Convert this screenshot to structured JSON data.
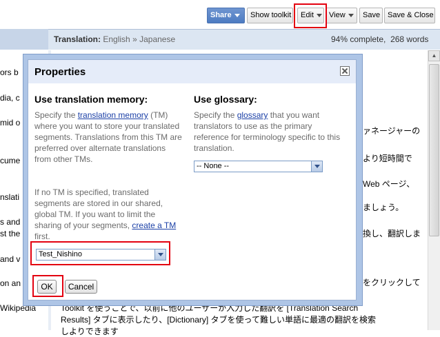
{
  "toolbar": {
    "share_label": "Share",
    "show_toolkit_label": "Show toolkit",
    "edit_label": "Edit",
    "view_label": "View",
    "save_label": "Save",
    "save_close_label": "Save & Close"
  },
  "header": {
    "title_prefix": "Translation:",
    "source_lang": "English",
    "separator": "»",
    "target_lang": "Japanese",
    "progress": "94% complete,",
    "word_count": "268 words"
  },
  "background": {
    "left_fragments": [
      "ors b",
      "dia, c",
      "mid o",
      "cume",
      "nslati",
      "s and",
      "st the",
      "and v",
      "on an",
      "Wikipedia"
    ],
    "right_lines": [
      "ァネージャーの",
      "より短時間で",
      "Web ページ、",
      "ましょう。",
      "換し、翻訳しま",
      "をクリックして",
      "Toolkit を使うことで、以前に他のユーザーが入力した翻訳を [Translation Search",
      "Results] タブに表示したり、[Dictionary] タブを使って難しい単語に最適の翻訳を検索",
      "しよりできます"
    ]
  },
  "dialog": {
    "title": "Properties",
    "tm": {
      "heading": "Use translation memory:",
      "p1_a": "Specify the ",
      "p1_link": "translation memory",
      "p1_b": " (TM) where you want to store your translated segments. Translations from this TM are preferred over alternate translations from other TMs.",
      "p2_a": "If no TM is specified, translated segments are stored in our shared, global TM. If you want to limit the sharing of your segments, ",
      "p2_link": "create a TM",
      "p2_b": " first.",
      "selected": "Test_Nishino"
    },
    "glossary": {
      "heading": "Use glossary:",
      "p1_a": "Specify the ",
      "p1_link": "glossary",
      "p1_b": " that you want translators to use as the primary reference for terminology specific to this translation.",
      "selected": "-- None --"
    },
    "ok_label": "OK",
    "cancel_label": "Cancel"
  },
  "colors": {
    "highlight_red": "#e3000f",
    "share_blue": "#4d7bc2",
    "dialog_frame": "#aec5e6",
    "link": "#1a3fa6"
  }
}
